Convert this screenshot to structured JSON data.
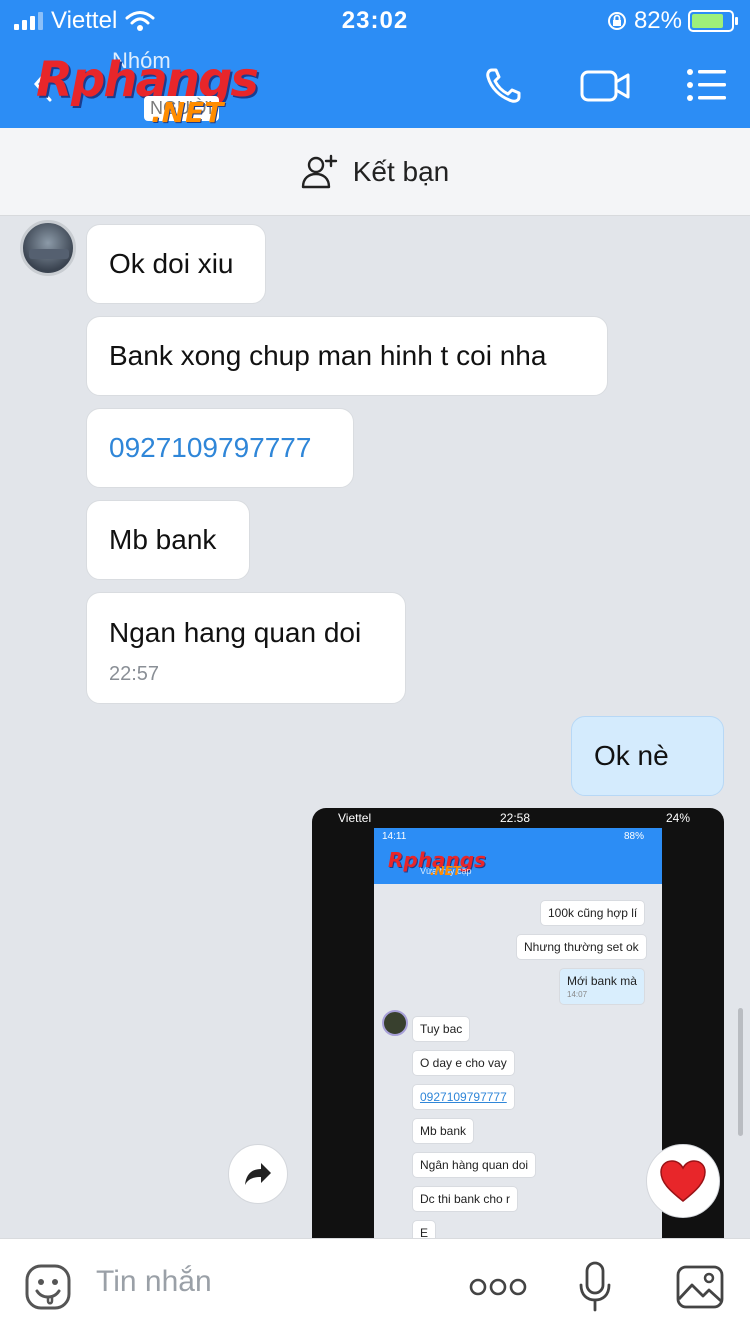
{
  "status_bar": {
    "carrier": "Viettel",
    "time": "23:02",
    "battery": "82%",
    "battery_level": 0.82
  },
  "header": {
    "contact_name": "Nhóm",
    "contact_status": "NGƯỜI",
    "logo_text": "Rphangs",
    "logo_net": ".NET"
  },
  "friend_bar": {
    "label": "Kết bạn"
  },
  "messages": [
    {
      "text": "Ok doi xiu"
    },
    {
      "text": "Bank xong chup man hinh t coi nha"
    },
    {
      "text": "0927109797777"
    },
    {
      "text": "Mb bank"
    },
    {
      "text": "Ngan hang quan doi",
      "time": "22:57"
    }
  ],
  "my_message": {
    "text": "Ok nè"
  },
  "shared_screenshot": {
    "status": {
      "carrier": "Viettel",
      "time": "22:58",
      "battery": "24%"
    },
    "inner_status": {
      "time": "14:11",
      "battery": "88%"
    },
    "inner_subtitle": "Vừa truy cập",
    "messages": [
      {
        "text": "100k cũng hợp lí"
      },
      {
        "text": "Nhưng thường set ok"
      },
      {
        "text": "Mới bank mà",
        "time": "14:07"
      },
      {
        "text": "Tuy bac"
      },
      {
        "text": "O day e cho vay"
      },
      {
        "text": "0927109797777"
      },
      {
        "text": "Mb bank"
      },
      {
        "text": "Ngân hàng quan doi"
      },
      {
        "text": "Dc thi bank cho r"
      },
      {
        "text": "E"
      }
    ]
  },
  "composer": {
    "placeholder": "Tin nhắn"
  },
  "colors": {
    "header_blue": "#2c8df5",
    "link_blue": "#2f86d8",
    "my_bubble": "#d4ebfd",
    "heart_red": "#e8262a"
  }
}
